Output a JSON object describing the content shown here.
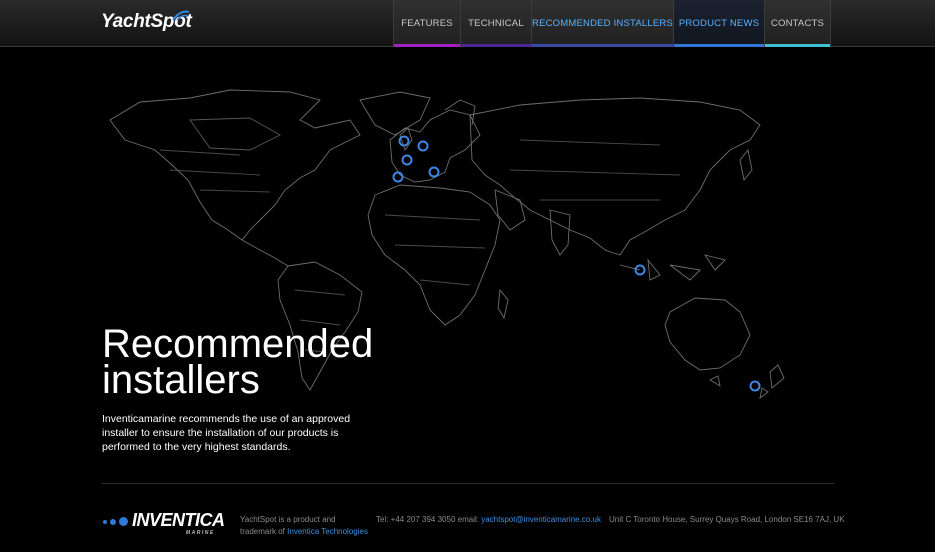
{
  "header": {
    "logo_text": "YachtSpot",
    "nav": [
      {
        "label": "FEATURES",
        "color": "#a020c0"
      },
      {
        "label": "TECHNICAL",
        "color": "#4a2a9a"
      },
      {
        "label": "RECOMMENDED INSTALLERS",
        "color": "#3a4aa0"
      },
      {
        "label": "PRODUCT NEWS",
        "color": "#2f78d8"
      },
      {
        "label": "CONTACTS",
        "color": "#3ec0d0"
      }
    ],
    "active_index": 3
  },
  "hero": {
    "title_line1": "Recommended",
    "title_line2": "installers",
    "description": "Inventicamarine recommends the use of an approved installer to ensure the installation of our products is performed to the very highest standards."
  },
  "footer": {
    "brand": "INVENTICA",
    "brand_sub": "MARINE",
    "about_line1": "YachtSpot is a product and",
    "about_line2": "trademark of",
    "about_link": "Inventica Technologies",
    "tel": "Tel: +44 207 394 3050 email:",
    "email": "yachtspot@inventicamarine.co.uk",
    "address": "Unit C Toronto House, Surrey Quays Road, London SE16 7AJ, UK"
  },
  "colors": {
    "marker": "#3d86e6",
    "map_line": "#7a7a7a",
    "link": "#3d8fe0"
  }
}
